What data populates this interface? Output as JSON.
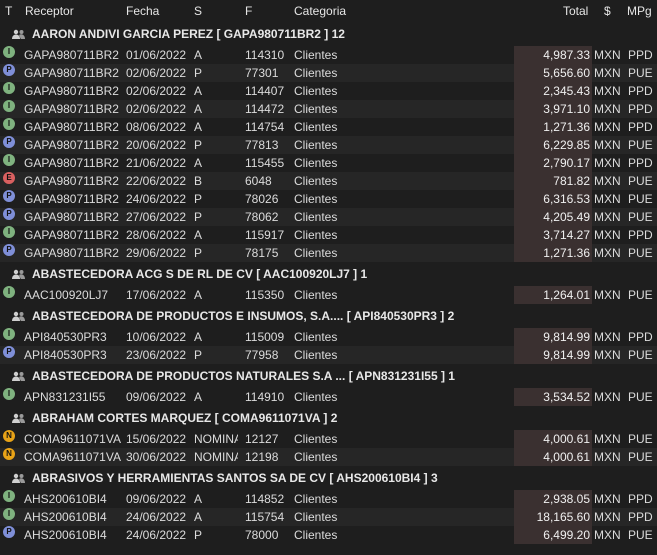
{
  "header": {
    "t": "T",
    "receptor": "Receptor",
    "fecha": "Fecha",
    "s": "S",
    "f": "F",
    "categoria": "Categoria",
    "total": "Total",
    "currency": "$",
    "mpg": "MPg"
  },
  "colors": {
    "I": "#7fb27f",
    "P": "#7f8fd8",
    "E": "#d96060",
    "N": "#e8a317",
    "total_bg": "#3a3030"
  },
  "groups": [
    {
      "name": "AARON ANDIVI GARCIA PEREZ  [ GAPA980711BR2 ]   12",
      "rows": [
        {
          "t": "I",
          "r": "GAPA980711BR2",
          "d": "01/06/2022",
          "s": "A",
          "f": "114310",
          "c": "Clientes",
          "total": "4,987.33",
          "cur": "MXN",
          "m": "PPD"
        },
        {
          "t": "P",
          "r": "GAPA980711BR2",
          "d": "02/06/2022",
          "s": "P",
          "f": "77301",
          "c": "Clientes",
          "total": "5,656.60",
          "cur": "MXN",
          "m": "PUE"
        },
        {
          "t": "I",
          "r": "GAPA980711BR2",
          "d": "02/06/2022",
          "s": "A",
          "f": "114407",
          "c": "Clientes",
          "total": "2,345.43",
          "cur": "MXN",
          "m": "PPD"
        },
        {
          "t": "I",
          "r": "GAPA980711BR2",
          "d": "02/06/2022",
          "s": "A",
          "f": "114472",
          "c": "Clientes",
          "total": "3,971.10",
          "cur": "MXN",
          "m": "PPD"
        },
        {
          "t": "I",
          "r": "GAPA980711BR2",
          "d": "08/06/2022",
          "s": "A",
          "f": "114754",
          "c": "Clientes",
          "total": "1,271.36",
          "cur": "MXN",
          "m": "PPD"
        },
        {
          "t": "P",
          "r": "GAPA980711BR2",
          "d": "20/06/2022",
          "s": "P",
          "f": "77813",
          "c": "Clientes",
          "total": "6,229.85",
          "cur": "MXN",
          "m": "PUE"
        },
        {
          "t": "I",
          "r": "GAPA980711BR2",
          "d": "21/06/2022",
          "s": "A",
          "f": "115455",
          "c": "Clientes",
          "total": "2,790.17",
          "cur": "MXN",
          "m": "PPD"
        },
        {
          "t": "E",
          "r": "GAPA980711BR2",
          "d": "22/06/2022",
          "s": "B",
          "f": "6048",
          "c": "Clientes",
          "total": "781.82",
          "cur": "MXN",
          "m": "PUE"
        },
        {
          "t": "P",
          "r": "GAPA980711BR2",
          "d": "24/06/2022",
          "s": "P",
          "f": "78026",
          "c": "Clientes",
          "total": "6,316.53",
          "cur": "MXN",
          "m": "PUE"
        },
        {
          "t": "P",
          "r": "GAPA980711BR2",
          "d": "27/06/2022",
          "s": "P",
          "f": "78062",
          "c": "Clientes",
          "total": "4,205.49",
          "cur": "MXN",
          "m": "PUE"
        },
        {
          "t": "I",
          "r": "GAPA980711BR2",
          "d": "28/06/2022",
          "s": "A",
          "f": "115917",
          "c": "Clientes",
          "total": "3,714.27",
          "cur": "MXN",
          "m": "PPD"
        },
        {
          "t": "P",
          "r": "GAPA980711BR2",
          "d": "29/06/2022",
          "s": "P",
          "f": "78175",
          "c": "Clientes",
          "total": "1,271.36",
          "cur": "MXN",
          "m": "PUE"
        }
      ]
    },
    {
      "name": "ABASTECEDORA ACG S DE RL DE CV  [ AAC100920LJ7 ]   1",
      "rows": [
        {
          "t": "I",
          "r": "AAC100920LJ7",
          "d": "17/06/2022",
          "s": "A",
          "f": "115350",
          "c": "Clientes",
          "total": "1,264.01",
          "cur": "MXN",
          "m": "PUE"
        }
      ]
    },
    {
      "name": "ABASTECEDORA DE PRODUCTOS E INSUMOS, S.A....  [ API840530PR3 ]   2",
      "rows": [
        {
          "t": "I",
          "r": "API840530PR3",
          "d": "10/06/2022",
          "s": "A",
          "f": "115009",
          "c": "Clientes",
          "total": "9,814.99",
          "cur": "MXN",
          "m": "PPD"
        },
        {
          "t": "P",
          "r": "API840530PR3",
          "d": "23/06/2022",
          "s": "P",
          "f": "77958",
          "c": "Clientes",
          "total": "9,814.99",
          "cur": "MXN",
          "m": "PUE"
        }
      ]
    },
    {
      "name": "ABASTECEDORA DE PRODUCTOS NATURALES S.A ...  [ APN831231I55 ]   1",
      "rows": [
        {
          "t": "I",
          "r": "APN831231I55",
          "d": "09/06/2022",
          "s": "A",
          "f": "114910",
          "c": "Clientes",
          "total": "3,534.52",
          "cur": "MXN",
          "m": "PUE"
        }
      ]
    },
    {
      "name": "ABRAHAM CORTES MARQUEZ  [ COMA9611071VA ]   2",
      "rows": [
        {
          "t": "N",
          "r": "COMA9611071VA",
          "d": "15/06/2022",
          "s": "NOMINA",
          "f": "12127",
          "c": "Clientes",
          "total": "4,000.61",
          "cur": "MXN",
          "m": "PUE"
        },
        {
          "t": "N",
          "r": "COMA9611071VA",
          "d": "30/06/2022",
          "s": "NOMINA",
          "f": "12198",
          "c": "Clientes",
          "total": "4,000.61",
          "cur": "MXN",
          "m": "PUE"
        }
      ]
    },
    {
      "name": "ABRASIVOS Y HERRAMIENTAS SANTOS SA DE CV  [ AHS200610BI4 ]   3",
      "rows": [
        {
          "t": "I",
          "r": "AHS200610BI4",
          "d": "09/06/2022",
          "s": "A",
          "f": "114852",
          "c": "Clientes",
          "total": "2,938.05",
          "cur": "MXN",
          "m": "PPD"
        },
        {
          "t": "I",
          "r": "AHS200610BI4",
          "d": "24/06/2022",
          "s": "A",
          "f": "115754",
          "c": "Clientes",
          "total": "18,165.60",
          "cur": "MXN",
          "m": "PPD"
        },
        {
          "t": "P",
          "r": "AHS200610BI4",
          "d": "24/06/2022",
          "s": "P",
          "f": "78000",
          "c": "Clientes",
          "total": "6,499.20",
          "cur": "MXN",
          "m": "PUE"
        }
      ]
    }
  ]
}
